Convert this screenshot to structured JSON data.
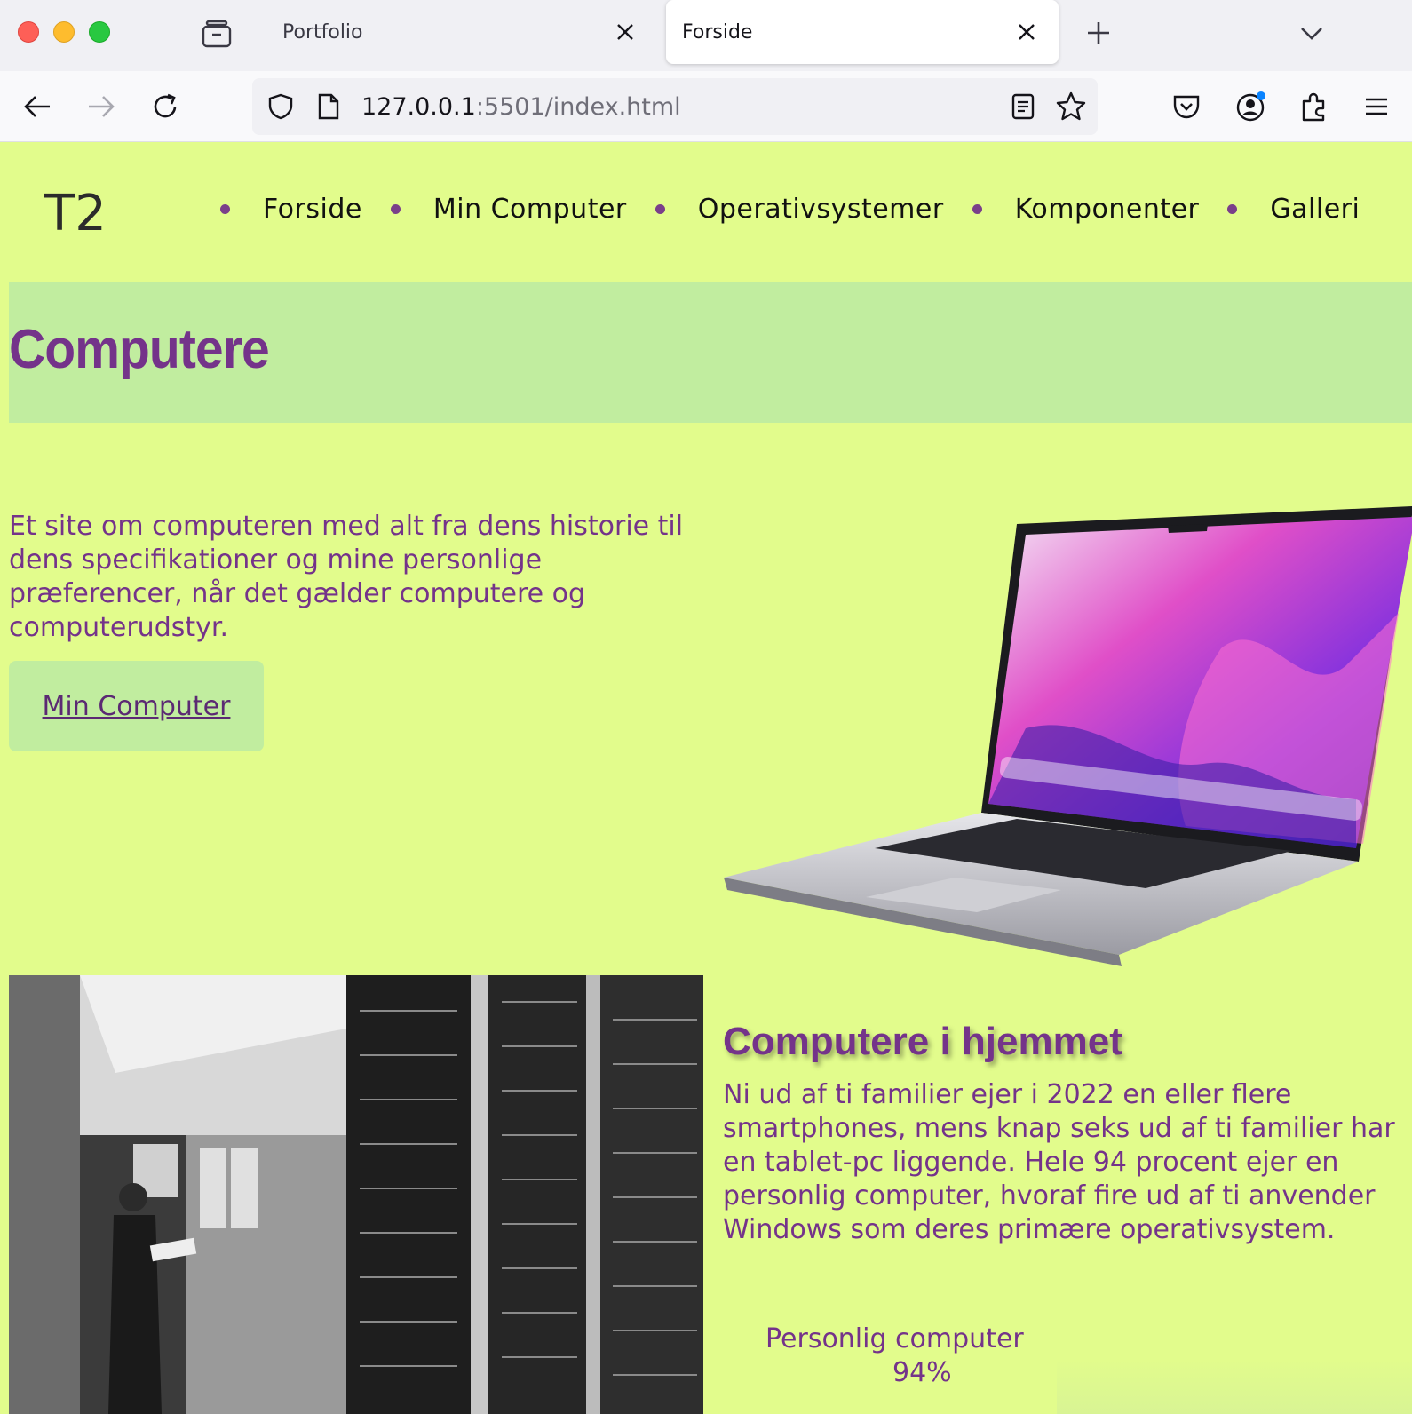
{
  "browser": {
    "tabs": [
      {
        "title": "Portfolio",
        "active": false
      },
      {
        "title": "Forside",
        "active": true
      }
    ],
    "url": {
      "host": "127.0.0.1",
      "rest": ":5501/index.html"
    }
  },
  "site": {
    "logo": "T2",
    "nav": [
      "Forside",
      "Min Computer",
      "Operativsystemer",
      "Komponenter",
      "Galleri"
    ],
    "banner_title": "Computere",
    "intro": "Et site om computeren med alt fra dens historie til dens specifikationer og mine personlige præferencer, når det gælder computere og computerudstyr.",
    "cta_label": "Min Computer",
    "section": {
      "title": "Computere i hjemmet",
      "text": "Ni ud af ti familier ejer i 2022 en eller flere smartphones, mens knap seks ud af ti familier har en tablet-pc liggende. Hele 94 procent ejer en personlig computer, hvoraf fire ud af ti anvender Windows som deres primære operativsystem.",
      "stat_label": "Personlig computer",
      "stat_value": "94%"
    }
  },
  "colors": {
    "page_bg": "#e2fc8c",
    "banner_bg": "#c1ed9f",
    "accent_purple": "#74338a"
  },
  "icons": [
    "tab-overview-icon",
    "close-icon",
    "plus-icon",
    "chevron-down-icon",
    "back-arrow-icon",
    "forward-arrow-icon",
    "reload-icon",
    "shield-icon",
    "page-icon",
    "reader-view-icon",
    "star-icon",
    "pocket-icon",
    "account-icon",
    "extensions-icon",
    "menu-icon"
  ]
}
